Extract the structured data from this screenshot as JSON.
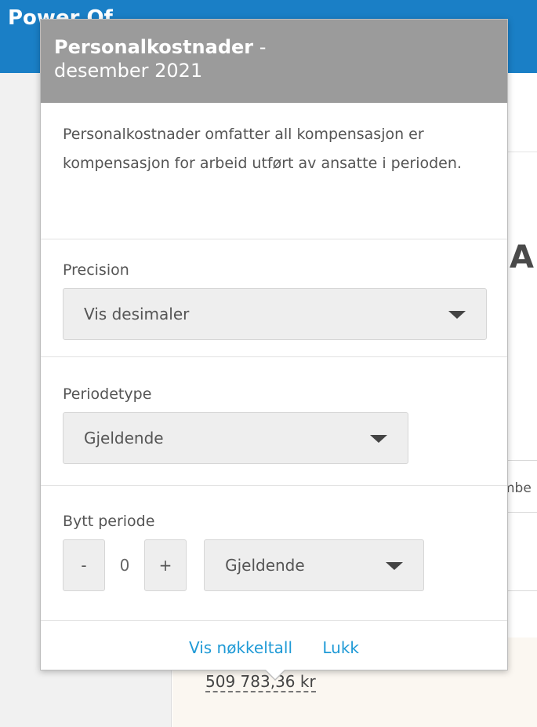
{
  "background": {
    "brand": "Power Of",
    "big_letter": "A",
    "fragment": "mbe",
    "value": "509 783,36 kr"
  },
  "popover": {
    "title_strong": "Personalkostnader",
    "title_sep": " -",
    "title_period": "desember 2021",
    "description": "Personalkostnader omfatter all kompensasjon er kompensasjon for arbeid utført av ansatte i perioden.",
    "precision": {
      "label": "Precision",
      "value": "Vis desimaler"
    },
    "period_type": {
      "label": "Periodetype",
      "value": "Gjeldende"
    },
    "switch_period": {
      "label": "Bytt periode",
      "minus": "-",
      "counter": "0",
      "plus": "+",
      "value": "Gjeldende"
    },
    "footer": {
      "show_kpi": "Vis nøkkeltall",
      "close": "Lukk"
    }
  }
}
